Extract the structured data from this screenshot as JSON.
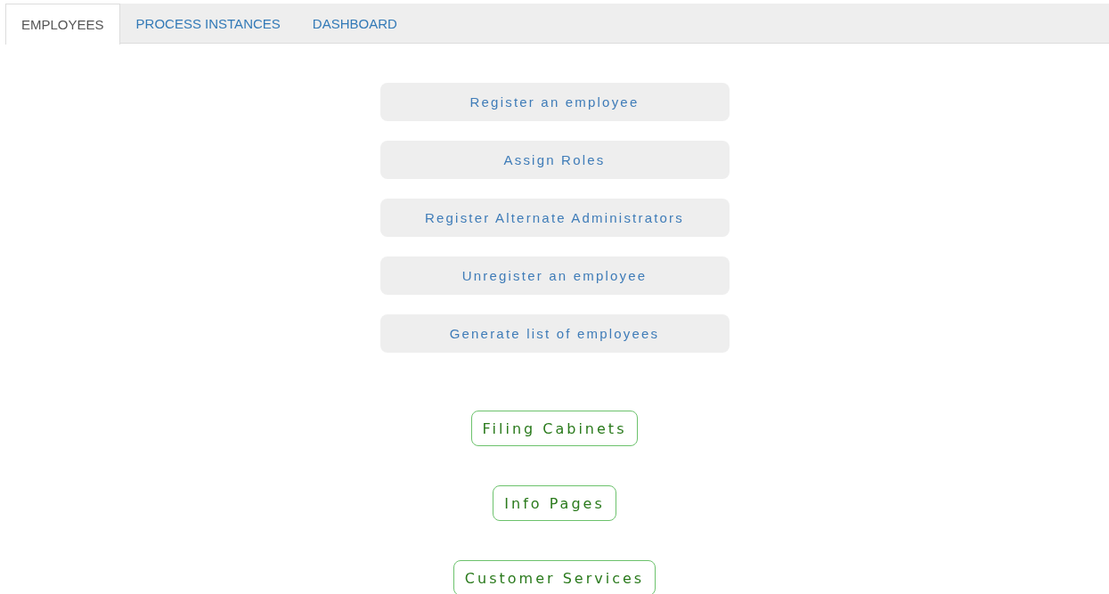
{
  "tabs": [
    {
      "label": "EMPLOYEES",
      "selected": true
    },
    {
      "label": "PROCESS INSTANCES",
      "selected": false
    },
    {
      "label": "DASHBOARD",
      "selected": false
    }
  ],
  "actions": [
    "Register an employee",
    "Assign Roles",
    "Register Alternate Administrators",
    "Unregister an employee",
    "Generate list of employees"
  ],
  "links": [
    "Filing Cabinets",
    "Info Pages",
    "Customer Services"
  ]
}
